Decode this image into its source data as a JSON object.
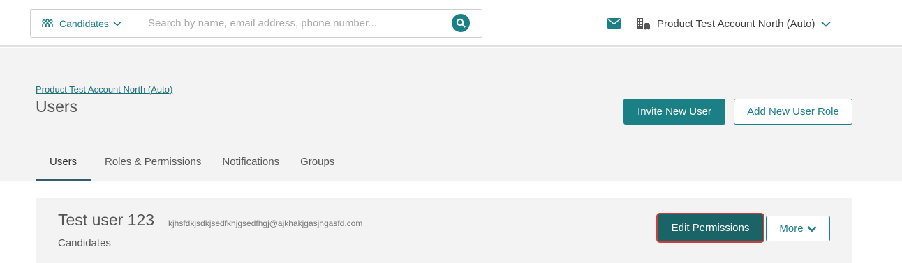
{
  "colors": {
    "accent": "#1b7f86",
    "accent_dark": "#1a6366",
    "highlight": "#d23b3b",
    "panel_bg": "#f3f3f3"
  },
  "topbar": {
    "entity_selector": {
      "label": "Candidates",
      "icon": "people-icon"
    },
    "search": {
      "placeholder": "Search by name, email address, phone number...",
      "value": "",
      "icon": "search-icon"
    },
    "mail_icon": "envelope-icon",
    "account": {
      "name": "Product Test Account North (Auto)",
      "icon": "building-icon"
    }
  },
  "header": {
    "breadcrumb": "Product Test Account North (Auto)",
    "title": "Users",
    "actions": {
      "invite_label": "Invite New User",
      "add_role_label": "Add New User Role"
    },
    "tabs": [
      {
        "label": "Users",
        "active": true
      },
      {
        "label": "Roles & Permissions",
        "active": false
      },
      {
        "label": "Notifications",
        "active": false
      },
      {
        "label": "Groups",
        "active": false
      }
    ]
  },
  "users": [
    {
      "name": "Test user 123",
      "email": "kjhsfdkjsdkjsedfkhjgsedfhgj@ajkhakjgasjhgasfd.com",
      "role": "Candidates",
      "edit_label": "Edit Permissions",
      "more_label": "More"
    }
  ]
}
